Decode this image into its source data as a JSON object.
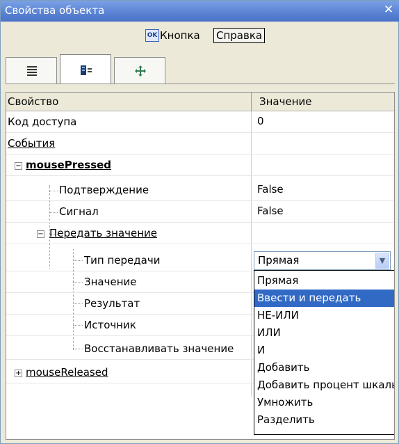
{
  "window": {
    "title": "Свойства объекта",
    "close_label": "✕"
  },
  "toolbar": {
    "ok_icon_text": "OK",
    "button_label": "Кнопка",
    "help_label": "Справка"
  },
  "tabs": [
    {
      "icon": "list-icon"
    },
    {
      "icon": "events-icon"
    },
    {
      "icon": "move-icon"
    }
  ],
  "grid": {
    "headers": {
      "property": "Свойство",
      "value": "Значение"
    },
    "rows": {
      "access_code": {
        "label": "Код доступа",
        "value": "0"
      },
      "events": {
        "label": "События"
      },
      "mouse_pressed": {
        "label": "mousePressed"
      },
      "confirmation": {
        "label": "Подтверждение",
        "value": "False"
      },
      "signal": {
        "label": "Сигнал",
        "value": "False"
      },
      "pass_value": {
        "label": "Передать значение"
      },
      "transfer_type": {
        "label": "Тип передачи",
        "value": "Прямая"
      },
      "value": {
        "label": "Значение"
      },
      "result": {
        "label": "Результат"
      },
      "source": {
        "label": "Источник"
      },
      "restore_value": {
        "label": "Восстанавливать значение"
      },
      "mouse_released": {
        "label": "mouseReleased"
      }
    }
  },
  "dropdown": {
    "selected": "Ввести и передать",
    "options": [
      "Прямая",
      "Ввести и передать",
      "НЕ-ИЛИ",
      "ИЛИ",
      "И",
      "Добавить",
      "Добавить процент шкалы",
      "Умножить",
      "Разделить"
    ]
  },
  "colors": {
    "title_bar": "#5a82d2",
    "selection": "#316ac5",
    "window_bg": "#ece9d8"
  }
}
